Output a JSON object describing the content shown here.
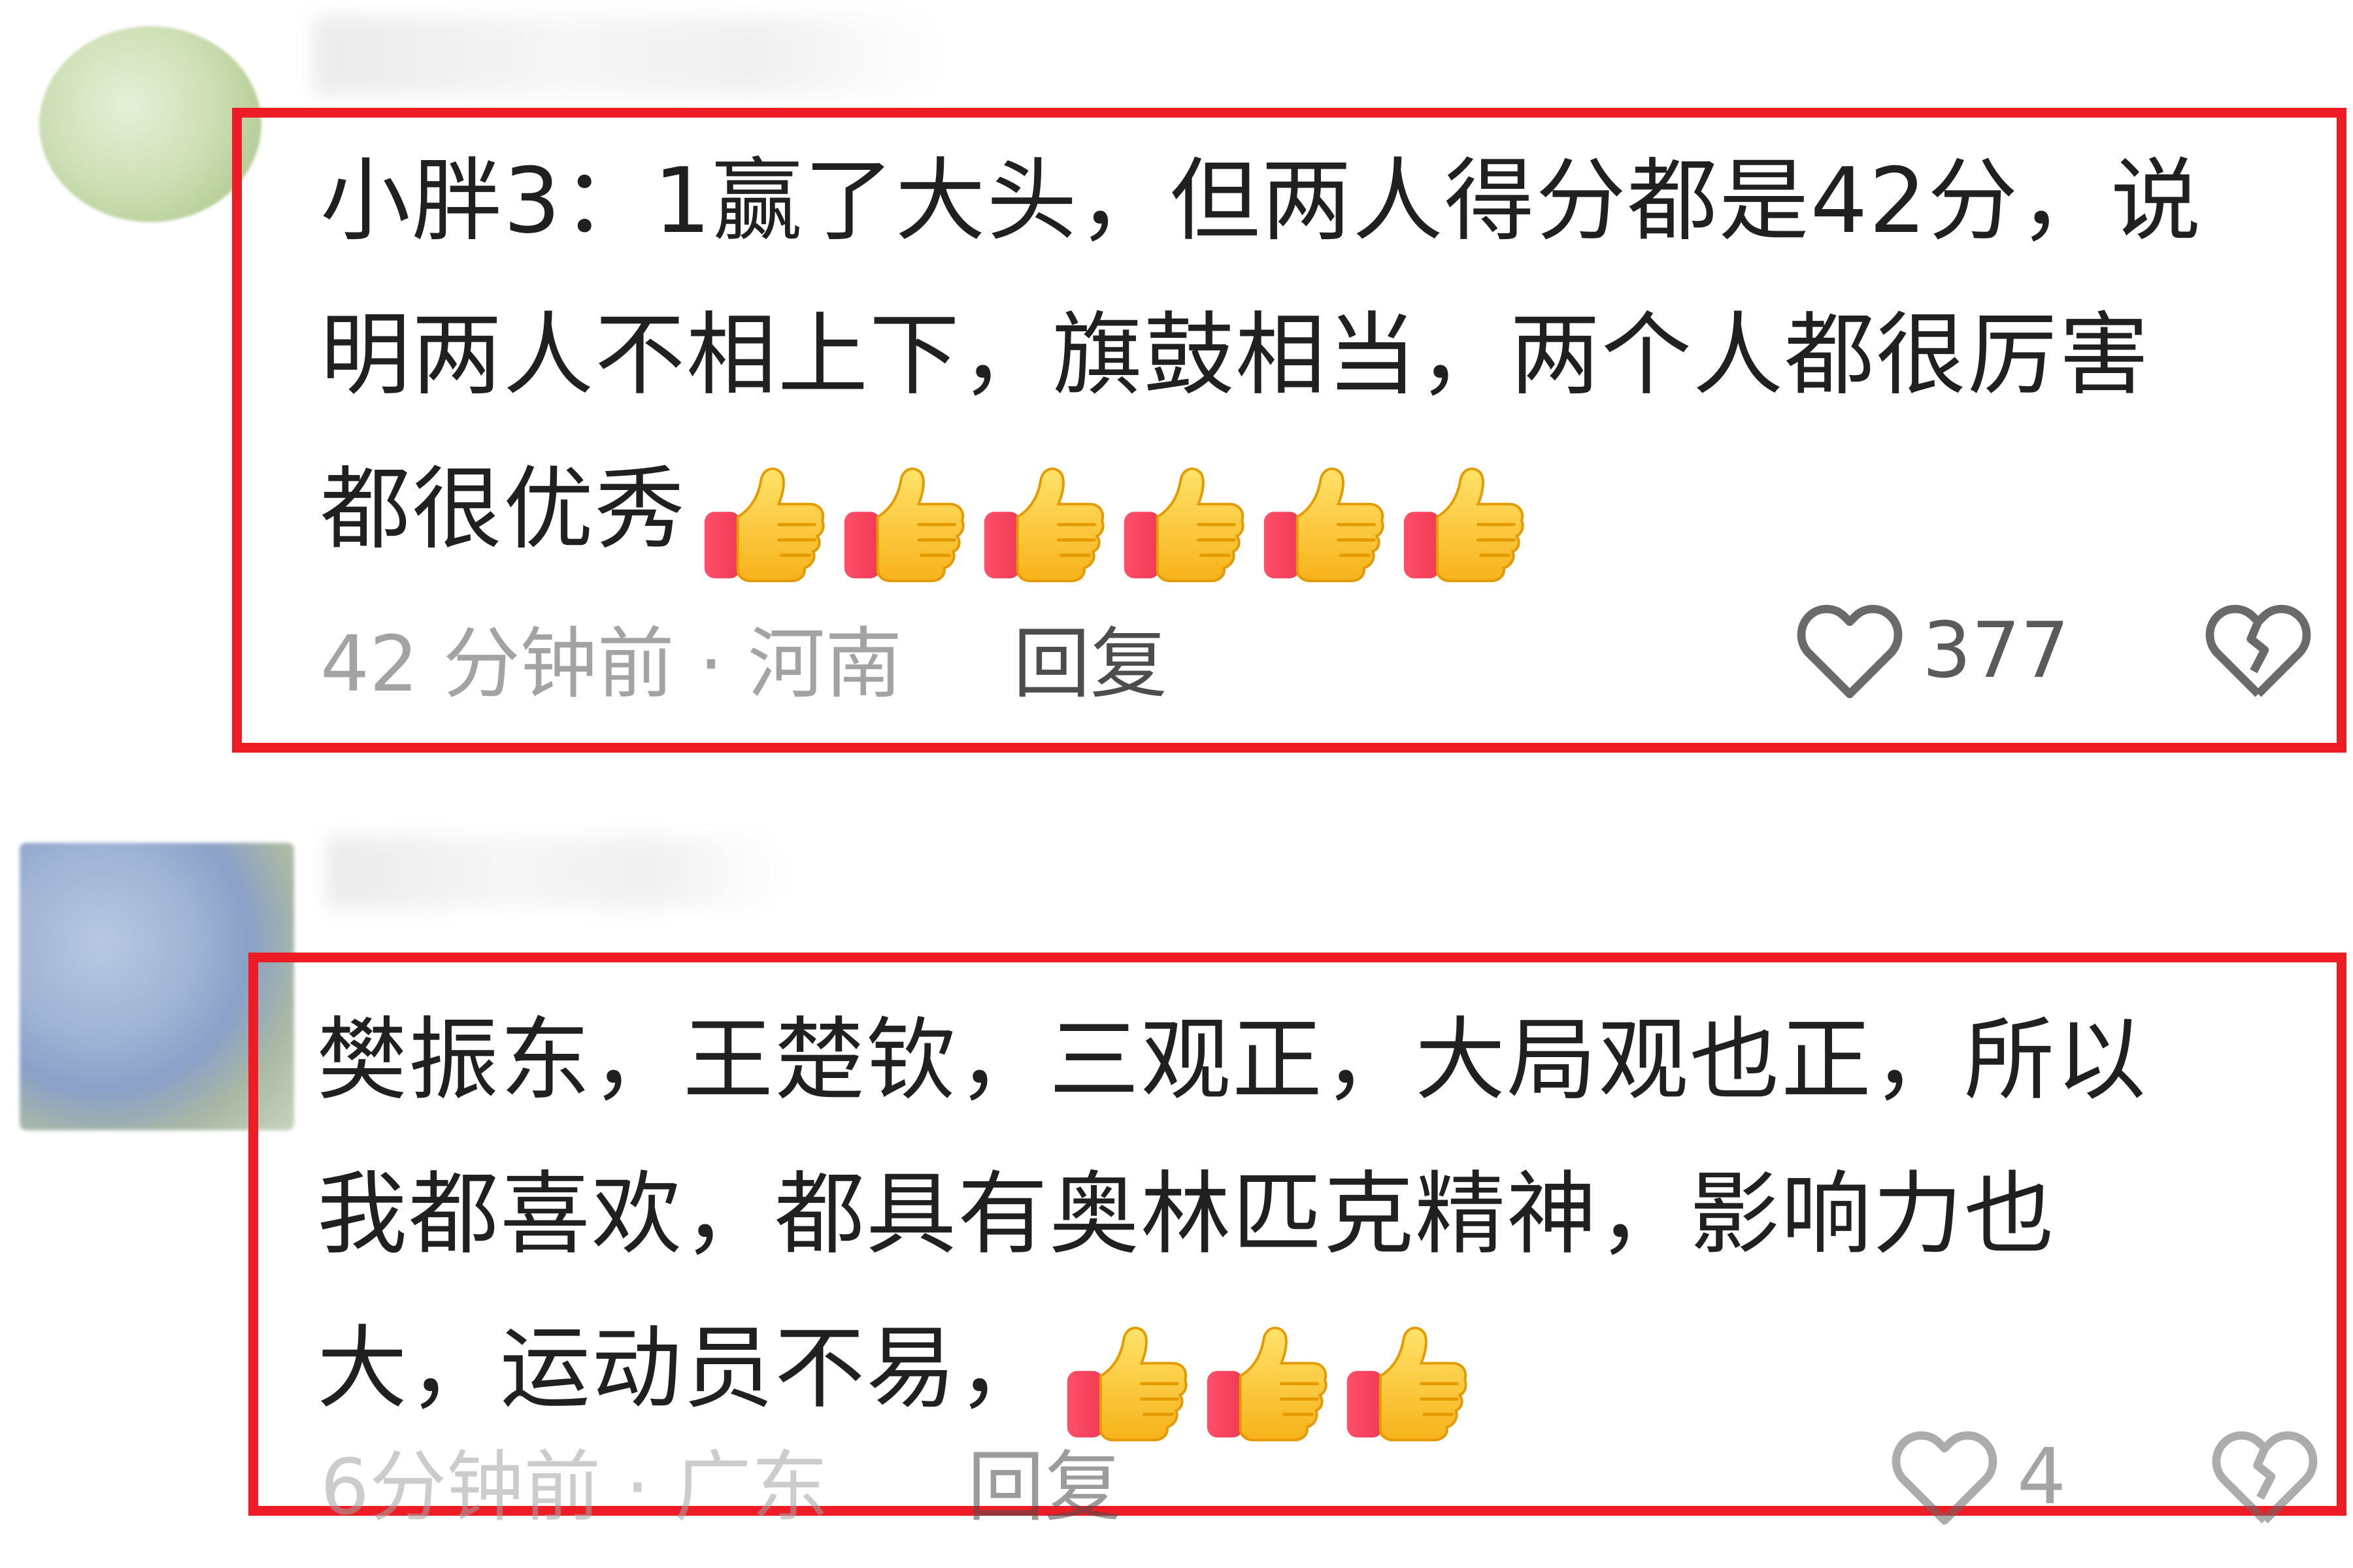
{
  "comments": [
    {
      "lines": [
        "小胖3：1赢了大头，但两人得分都是42分，说",
        "明两人不相上下，旗鼓相当，两个人都很厉害",
        "都很优秀"
      ],
      "emoji_icon": "thumbs-up-icon",
      "emoji_count": 6,
      "time_location": "42 分钟前 · 河南",
      "reply_label": "回复",
      "likes": "377"
    },
    {
      "lines": [
        "樊振东，王楚钦，三观正，大局观也正，所以",
        "我都喜欢，都具有奥林匹克精神，影响力也",
        "大，运动员不易，"
      ],
      "emoji_icon": "thumbs-up-icon",
      "emoji_count": 3,
      "time_location": "6分钟前 · 广东",
      "reply_label": "回复",
      "likes": "4"
    }
  ],
  "colors": {
    "highlight_frame": "#ee1c25",
    "meta_text": "#a3a3a3",
    "body_text": "#202020"
  }
}
